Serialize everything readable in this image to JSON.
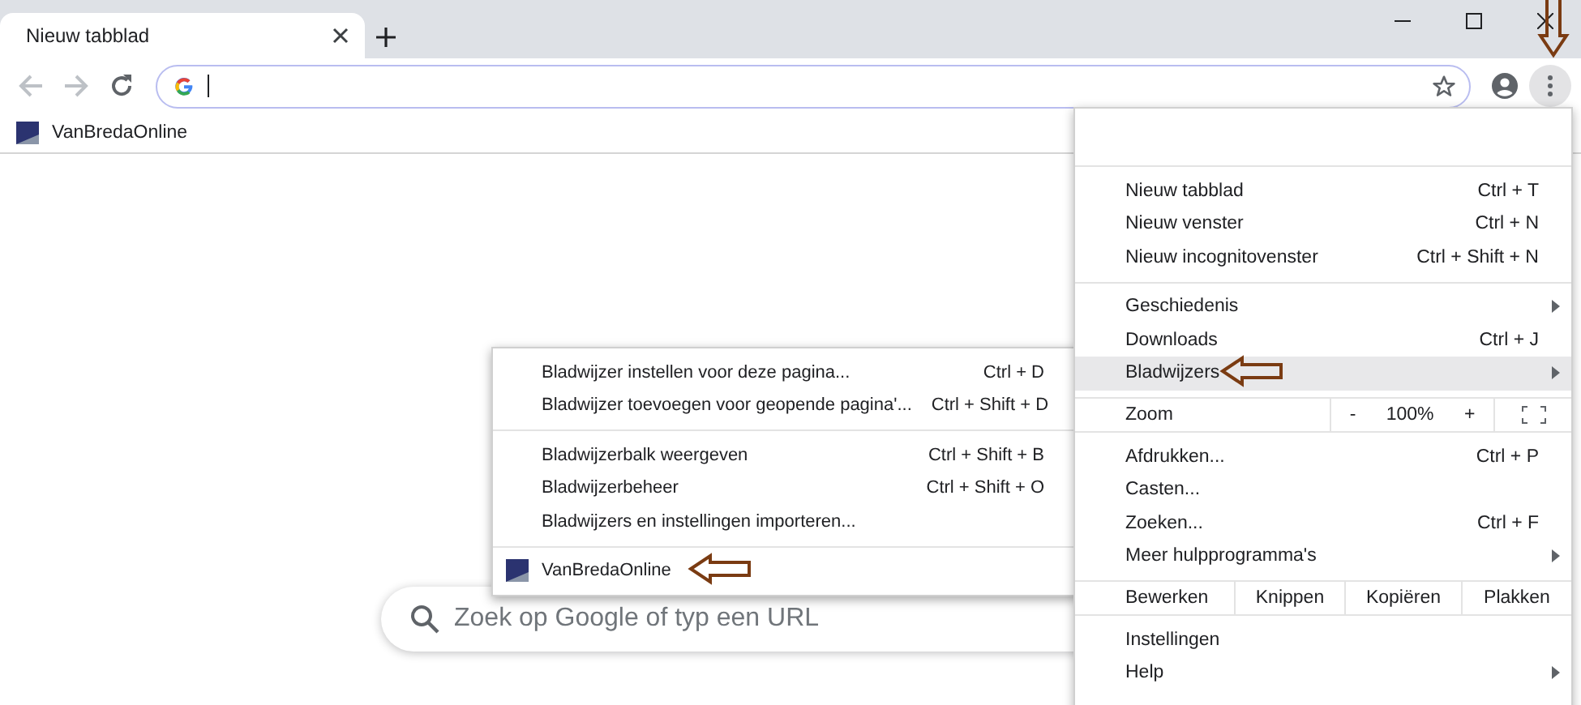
{
  "tabs": [
    {
      "label": "Nieuw tabblad",
      "selected": true
    }
  ],
  "bookmarks_bar": [
    {
      "label": "VanBredaOnline"
    }
  ],
  "search": {
    "placeholder": "Zoek op Google of typ een URL"
  },
  "menu": {
    "sections": [
      {
        "items": [
          {
            "kind": "item",
            "label": "Nieuw tabblad",
            "shortcut": "Ctrl + T",
            "submenu": false,
            "selected": false
          },
          {
            "kind": "item",
            "label": "Nieuw venster",
            "shortcut": "Ctrl + N",
            "submenu": false,
            "selected": false
          },
          {
            "kind": "item",
            "label": "Nieuw incognitovenster",
            "shortcut": "Ctrl + Shift + N",
            "submenu": false,
            "selected": false
          }
        ]
      },
      {
        "items": [
          {
            "kind": "item",
            "label": "Geschiedenis",
            "submenu": true,
            "selected": false
          },
          {
            "kind": "item",
            "label": "Downloads",
            "shortcut": "Ctrl + J",
            "submenu": false,
            "selected": false
          },
          {
            "kind": "item",
            "label": "Bladwijzers",
            "submenu": true,
            "selected": true
          }
        ]
      },
      {
        "items": [
          {
            "kind": "zoom",
            "label": "Zoom",
            "minus": "-",
            "value": "100%",
            "plus": "+"
          }
        ]
      },
      {
        "items": [
          {
            "kind": "item",
            "label": "Afdrukken...",
            "shortcut": "Ctrl + P",
            "submenu": false,
            "selected": false
          },
          {
            "kind": "item",
            "label": "Casten...",
            "submenu": false,
            "selected": false
          },
          {
            "kind": "item",
            "label": "Zoeken...",
            "shortcut": "Ctrl + F",
            "submenu": false,
            "selected": false
          },
          {
            "kind": "item",
            "label": "Meer hulpprogramma's",
            "submenu": true,
            "selected": false
          }
        ]
      },
      {
        "items": [
          {
            "kind": "edit",
            "label": "Bewerken",
            "actions": [
              "Knippen",
              "Kopiëren",
              "Plakken"
            ]
          }
        ]
      },
      {
        "items": [
          {
            "kind": "item",
            "label": "Instellingen",
            "submenu": false,
            "selected": false
          },
          {
            "kind": "item",
            "label": "Help",
            "submenu": true,
            "selected": false
          }
        ]
      }
    ]
  },
  "bookmarks_submenu": {
    "sections": [
      {
        "items": [
          {
            "kind": "item",
            "label": "Bladwijzer instellen voor deze pagina...",
            "shortcut": "Ctrl + D",
            "selected": false
          },
          {
            "kind": "item",
            "label": "Bladwijzer toevoegen voor geopende pagina'...",
            "shortcut": "Ctrl + Shift + D",
            "selected": false
          }
        ]
      },
      {
        "items": [
          {
            "kind": "item",
            "label": "Bladwijzerbalk weergeven",
            "shortcut": "Ctrl + Shift + B",
            "selected": false
          },
          {
            "kind": "item",
            "label": "Bladwijzerbeheer",
            "shortcut": "Ctrl + Shift + O",
            "selected": false
          },
          {
            "kind": "item",
            "label": "Bladwijzers en instellingen importeren...",
            "selected": false
          }
        ]
      },
      {
        "items": [
          {
            "kind": "bookmark",
            "label": "VanBredaOnline",
            "selected": false
          }
        ]
      }
    ]
  }
}
